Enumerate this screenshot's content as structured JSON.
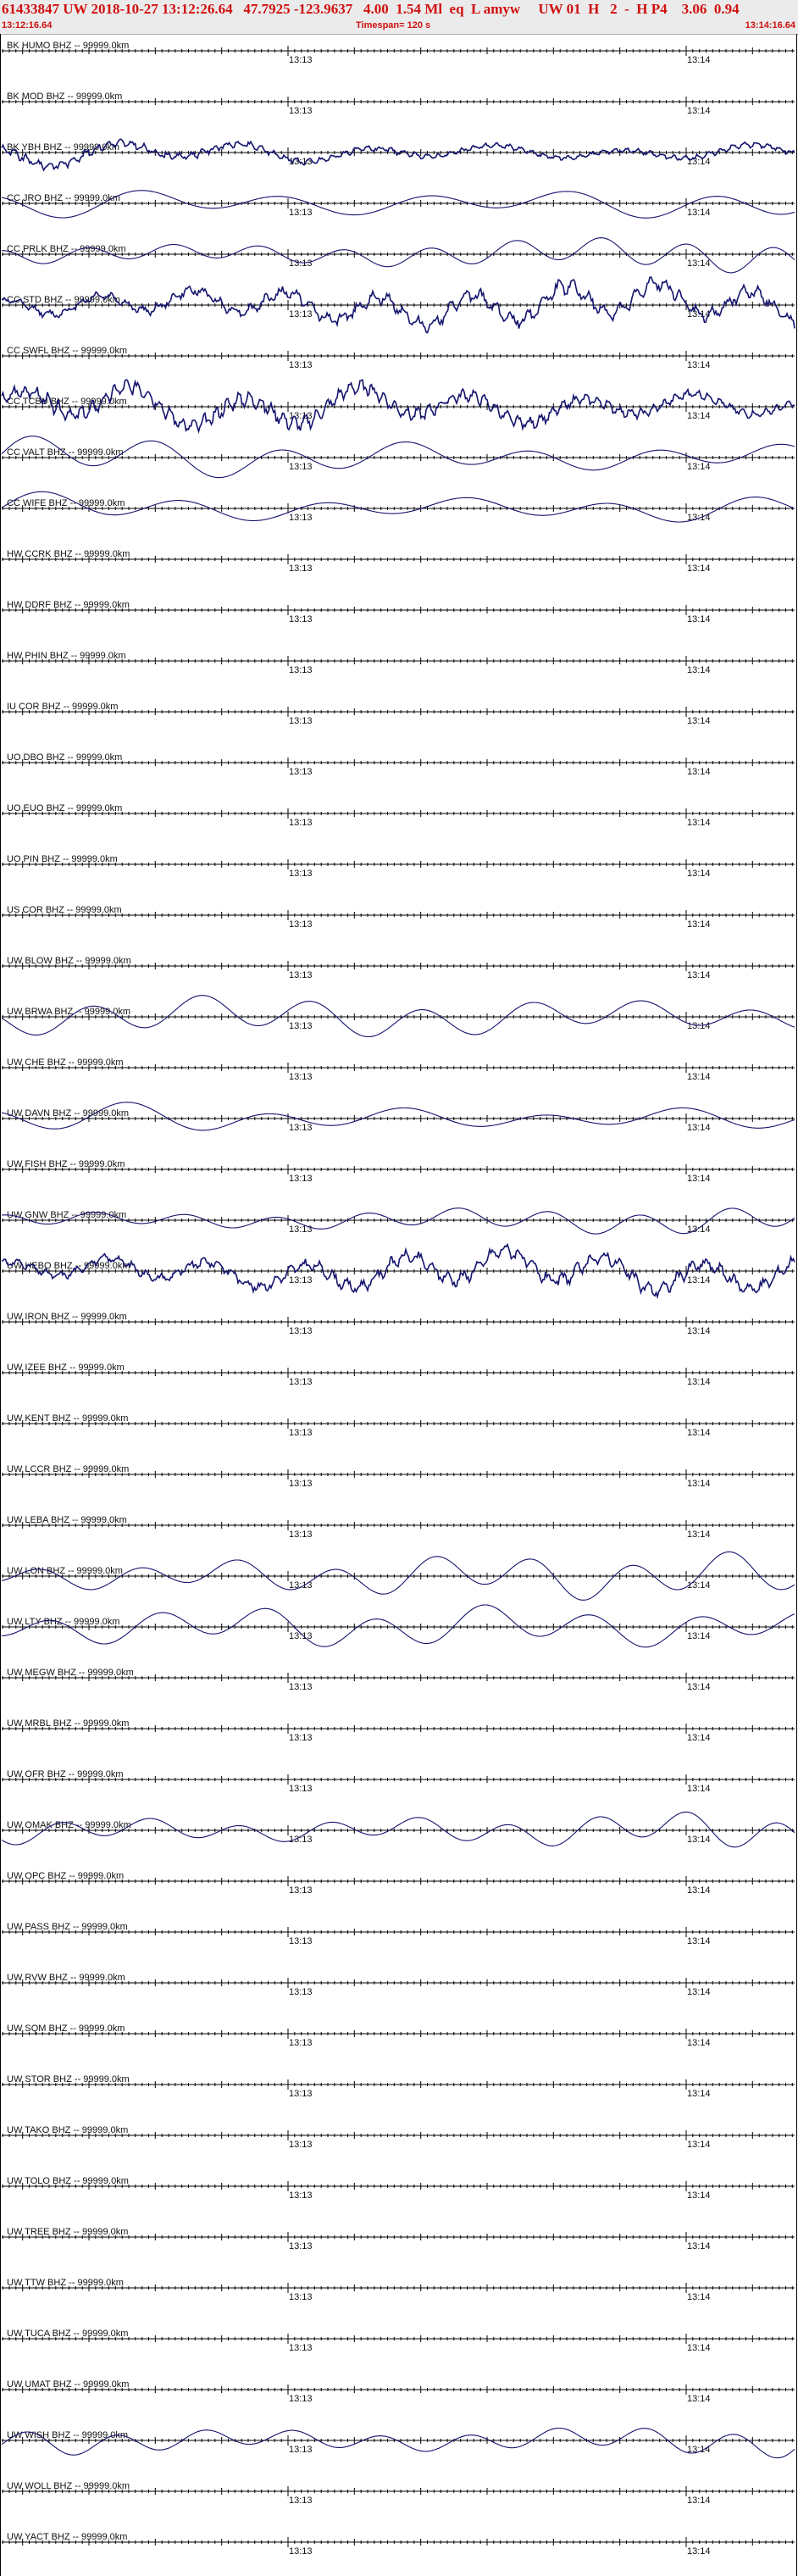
{
  "header": {
    "title": "61433847 UW 2018-10-27 13:12:26.64   47.7925 -123.9637   4.00  1.54 Ml  eq  L amyw     UW 01  H   2  -  H P4    3.06  0.94",
    "start_time": "13:12:16.64",
    "timespan": "Timespan= 120 s",
    "end_time": "13:14:16.64"
  },
  "time_marks": [
    "13:13",
    "13:14"
  ],
  "colors": {
    "trace": "#14146e",
    "header_text": "#d01010",
    "header_bg": "#ebebeb"
  },
  "traces": [
    {
      "label": "BK HUMO BHZ -- 99999.0km",
      "amp": 0
    },
    {
      "label": "BK MOD BHZ -- 99999.0km",
      "amp": 0
    },
    {
      "label": "BK YBH BHZ -- 99999.0km",
      "amp": 16
    },
    {
      "label": "CC JRO BHZ -- 99999.0km",
      "amp": 26
    },
    {
      "label": "CC PRLK BHZ -- 99999.0km",
      "amp": 22
    },
    {
      "label": "CC STD BHZ -- 99999.0km",
      "amp": 25
    },
    {
      "label": "CC SWFL BHZ -- 99999.0km",
      "amp": 0
    },
    {
      "label": "CC TCBU BHZ -- 99999.0km",
      "amp": 26
    },
    {
      "label": "CC VALT BHZ -- 99999.0km",
      "amp": 28
    },
    {
      "label": "CC WIFE BHZ -- 99999.0km",
      "amp": 24
    },
    {
      "label": "HW CCRK BHZ -- 99999.0km",
      "amp": 0
    },
    {
      "label": "HW DDRF BHZ -- 99999.0km",
      "amp": 0
    },
    {
      "label": "HW PHIN BHZ -- 99999.0km",
      "amp": 0
    },
    {
      "label": "IU COR BHZ -- 99999.0km",
      "amp": 0
    },
    {
      "label": "UO DBO BHZ -- 99999.0km",
      "amp": 0
    },
    {
      "label": "UO EUO BHZ -- 99999.0km",
      "amp": 0
    },
    {
      "label": "UO PIN BHZ -- 99999.0km",
      "amp": 0
    },
    {
      "label": "US COR BHZ -- 99999.0km",
      "amp": 0
    },
    {
      "label": "UW BLOW BHZ -- 99999.0km",
      "amp": 0
    },
    {
      "label": "UW BRWA BHZ -- 99999.0km",
      "amp": 25
    },
    {
      "label": "UW CHE BHZ -- 99999.0km",
      "amp": 0
    },
    {
      "label": "UW DAVN BHZ -- 99999.0km",
      "amp": 22
    },
    {
      "label": "UW FISH BHZ -- 99999.0km",
      "amp": 0
    },
    {
      "label": "UW GNW BHZ -- 99999.0km",
      "amp": 18
    },
    {
      "label": "UW HEBO BHZ -- 99999.0km",
      "amp": 24
    },
    {
      "label": "UW IRON BHZ -- 99999.0km",
      "amp": 0
    },
    {
      "label": "UW IZEE BHZ -- 99999.0km",
      "amp": 0
    },
    {
      "label": "UW KENT BHZ -- 99999.0km",
      "amp": 0
    },
    {
      "label": "UW LCCR BHZ -- 99999.0km",
      "amp": 0
    },
    {
      "label": "UW LEBA BHZ -- 99999.0km",
      "amp": 0
    },
    {
      "label": "UW LON BHZ -- 99999.0km",
      "amp": 28
    },
    {
      "label": "UW LTY BHZ -- 99999.0km",
      "amp": 26
    },
    {
      "label": "UW MEGW BHZ -- 99999.0km",
      "amp": 0
    },
    {
      "label": "UW MRBL BHZ -- 99999.0km",
      "amp": 0
    },
    {
      "label": "UW OFR BHZ -- 99999.0km",
      "amp": 0
    },
    {
      "label": "UW OMAK BHZ -- 99999.0km",
      "amp": 26
    },
    {
      "label": "UW OPC BHZ -- 99999.0km",
      "amp": 0
    },
    {
      "label": "UW PASS BHZ -- 99999.0km",
      "amp": 0
    },
    {
      "label": "UW RVW BHZ -- 99999.0km",
      "amp": 0
    },
    {
      "label": "UW SQM BHZ -- 99999.0km",
      "amp": 0
    },
    {
      "label": "UW STOR BHZ -- 99999.0km",
      "amp": 0
    },
    {
      "label": "UW TAKO BHZ -- 99999.0km",
      "amp": 0
    },
    {
      "label": "UW TOLO BHZ -- 99999.0km",
      "amp": 0
    },
    {
      "label": "UW TREE BHZ -- 99999.0km",
      "amp": 0
    },
    {
      "label": "UW TTW BHZ -- 99999.0km",
      "amp": 0
    },
    {
      "label": "UW TUCA BHZ -- 99999.0km",
      "amp": 0
    },
    {
      "label": "UW UMAT BHZ -- 99999.0km",
      "amp": 0
    },
    {
      "label": "UW WISH BHZ -- 99999.0km",
      "amp": 24
    },
    {
      "label": "UW WOLL BHZ -- 99999.0km",
      "amp": 0
    },
    {
      "label": "UW YACT BHZ -- 99999.0km",
      "amp": 0
    }
  ]
}
